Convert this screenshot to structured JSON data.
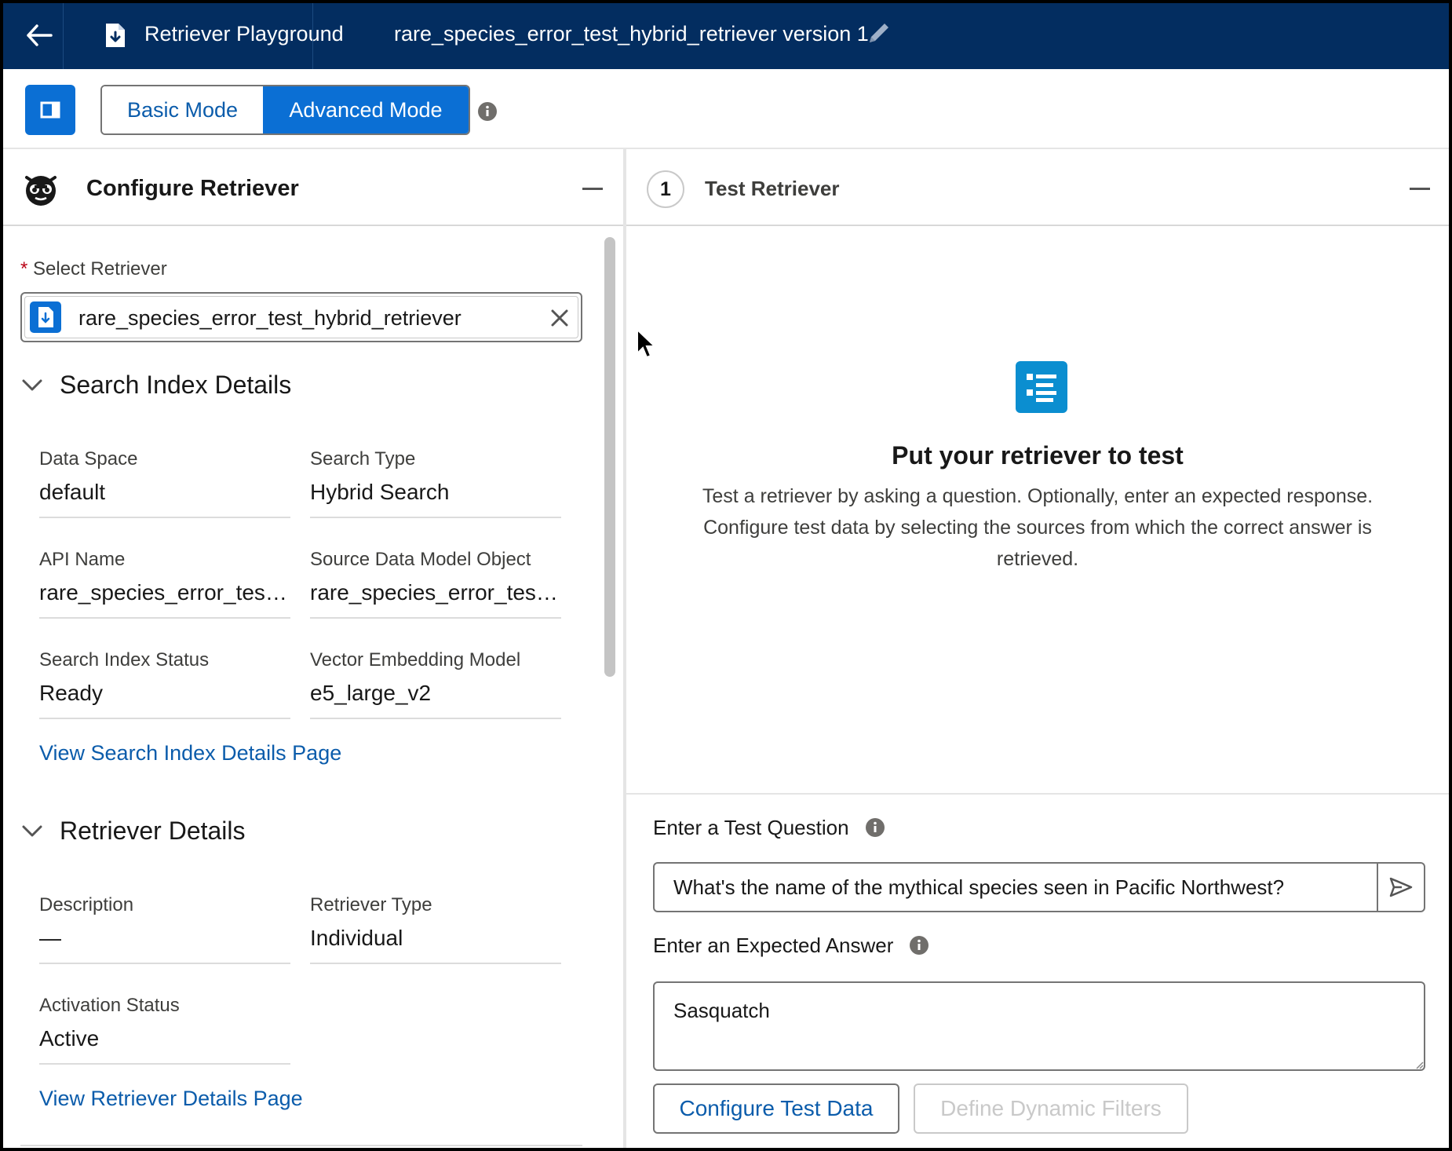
{
  "header": {
    "app_title": "Retriever Playground",
    "doc_title": "rare_species_error_test_hybrid_retriever version 1",
    "back_icon": "arrow-left-icon",
    "app_icon": "retriever-file-icon",
    "edit_icon": "pencil-icon"
  },
  "toolbar": {
    "modes": {
      "basic": "Basic Mode",
      "advanced": "Advanced Mode",
      "selected": "advanced"
    },
    "panel_toggle_icon": "panel-left-icon",
    "info_icon": "info-icon"
  },
  "configure": {
    "title": "Configure Retriever",
    "select_label": "Select Retriever",
    "required_marker": "*",
    "selected_retriever": "rare_species_error_test_hybrid_retriever",
    "search_index": {
      "heading": "Search Index Details",
      "data_space_label": "Data Space",
      "data_space_value": "default",
      "search_type_label": "Search Type",
      "search_type_value": "Hybrid Search",
      "api_name_label": "API Name",
      "api_name_value": "rare_species_error_test_hybrid_retriever",
      "source_object_label": "Source Data Model Object",
      "source_object_value": "rare_species_error_test_hybrid_retriever",
      "status_label": "Search Index Status",
      "status_value": "Ready",
      "embedding_label": "Vector Embedding Model",
      "embedding_value": "e5_large_v2",
      "link": "View Search Index Details Page"
    },
    "retriever_details": {
      "heading": "Retriever Details",
      "description_label": "Description",
      "description_value": "—",
      "type_label": "Retriever Type",
      "type_value": "Individual",
      "activation_label": "Activation Status",
      "activation_value": "Active",
      "link": "View Retriever Details Page"
    }
  },
  "test": {
    "step": "1",
    "title": "Test Retriever",
    "empty_title": "Put your retriever to test",
    "empty_desc": "Test a retriever by asking a question. Optionally, enter an expected response. Configure test data by selecting the sources from which the correct answer is retrieved.",
    "question_label": "Enter a Test Question",
    "question_value": "What's the name of the mythical species seen in Pacific Northwest?",
    "answer_label": "Enter an Expected Answer",
    "answer_value": "Sasquatch",
    "configure_btn": "Configure Test Data",
    "filters_btn": "Define Dynamic Filters"
  },
  "colors": {
    "nav_bg": "#032d60",
    "brand_blue": "#0b6fd4",
    "link_blue": "#0b5cab"
  }
}
